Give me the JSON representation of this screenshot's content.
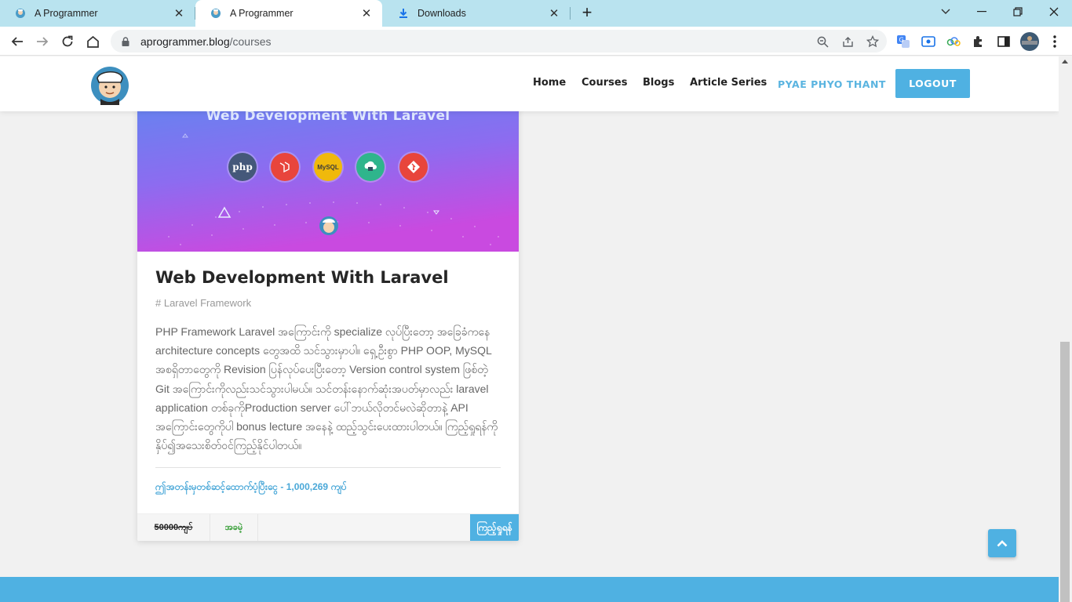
{
  "browser": {
    "tabs": [
      {
        "title": "A Programmer",
        "close": "✕",
        "active": false
      },
      {
        "title": "A Programmer",
        "close": "✕",
        "active": true
      },
      {
        "title": "Downloads",
        "close": "✕",
        "active": false
      }
    ],
    "new_tab": "+",
    "url_host": "aprogrammer.blog",
    "url_path": "/courses"
  },
  "site": {
    "nav": [
      "Home",
      "Courses",
      "Blogs",
      "Article Series"
    ],
    "user": "PYAE PHYO THANT",
    "logout": "LOGOUT"
  },
  "course": {
    "banner_title": "Web Development With Laravel",
    "tech_icons": [
      "php",
      "laravel",
      "mysql",
      "server",
      "git"
    ],
    "php_label": "php",
    "mysql_label": "MySQL",
    "title": "Web Development With Laravel",
    "tag": "# Laravel Framework",
    "description": "PHP Framework Laravel အကြောင်းကို specialize လုပ်ပြီးတော့ အခြေခံကနေ architecture concepts တွေအထိ သင်သွားမှာပါ။ ရှေ့ဦးစွာ PHP OOP, MySQL အစရှိတာတွေကို Revision ပြန်လုပ်ပေးပြီးတော့ Version control system ဖြစ်တဲ့ Git အကြောင်းကိုလည်းသင်သွားပါမယ်။ သင်တန်းနောက်ဆုံးအပတ်မှာလည်း laravel application တစ်ခုကိုProduction server ပေါ်ဘယ်လိုတင်မလဲဆိုတာနဲ့ API အကြောင်းတွေကိုပါ bonus lecture အနေနဲ့ ထည့်သွင်းပေးထားပါတယ်။ ကြည့်ရှုရန်ကိုနှိပ်၍အသေးစိတ်ဝင်ကြည့်နိုင်ပါတယ်။",
    "students": "ဤအတန်းမှတစ်ဆင့်ထောက်ပံ့ပြီးငွေ - 1,000,269 ကျပ်",
    "old_price": "50000ကျပ်",
    "free_label": "အခမဲ့",
    "view_label": "ကြည့်ရှုရန်"
  },
  "colors": {
    "accent": "#4fb1e2",
    "tab_bar": "#b9e3ef",
    "free": "#2f9b2f"
  }
}
